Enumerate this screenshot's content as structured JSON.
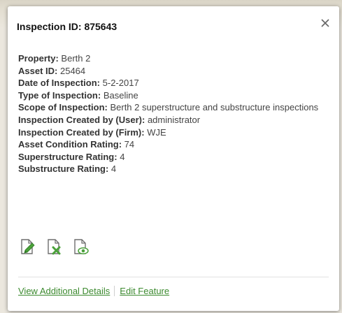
{
  "popup": {
    "title": "Inspection ID: 875643",
    "close_icon": "close-icon",
    "fields": [
      {
        "label": "Property:",
        "value": "Berth 2"
      },
      {
        "label": "Asset ID:",
        "value": "25464"
      },
      {
        "label": "Date of Inspection:",
        "value": "5-2-2017"
      },
      {
        "label": "Type of Inspection:",
        "value": "Baseline"
      },
      {
        "label": "Scope of Inspection:",
        "value": "Berth 2 superstructure and substructure inspections"
      },
      {
        "label": "Inspection Created by (User):",
        "value": "administrator"
      },
      {
        "label": "Inspection Created by (Firm):",
        "value": "WJE"
      },
      {
        "label": "Asset Condition Rating:",
        "value": "74"
      },
      {
        "label": "Superstructure Rating:",
        "value": "4"
      },
      {
        "label": "Substructure Rating:",
        "value": "4"
      }
    ],
    "actions": [
      {
        "icon": "edit-document-icon"
      },
      {
        "icon": "delete-document-icon"
      },
      {
        "icon": "view-document-icon"
      }
    ],
    "footer": {
      "view_details": "View Additional Details",
      "edit_feature": "Edit Feature"
    },
    "colors": {
      "link": "#3c8a2f",
      "icon_green": "#4aa13a",
      "icon_gray": "#6e6e6e"
    }
  }
}
